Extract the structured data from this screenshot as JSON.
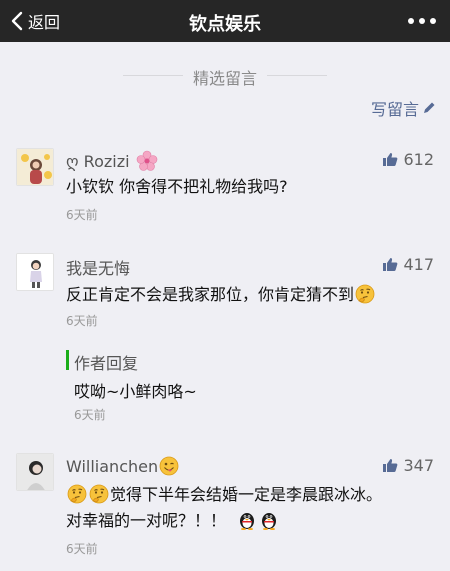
{
  "navbar": {
    "back_label": "返回",
    "title": "钦点娱乐"
  },
  "section": {
    "title": "精选留言",
    "write_label": "写留言"
  },
  "colors": {
    "navbar_bg": "#262626",
    "link": "#576b95",
    "reply_accent": "#1aad19"
  },
  "comments": [
    {
      "nickname": "ღ Rozizi",
      "nickname_icon": "cherry-blossom-icon",
      "likes": "612",
      "content": "小钦钦  你舍得不把礼物给我吗?",
      "time": "6天前"
    },
    {
      "nickname": "我是无悔",
      "likes": "417",
      "content": "反正肯定不会是我家那位，你肯定猜不到",
      "content_emoji": "thinking-face-icon",
      "time": "6天前",
      "reply": {
        "label": "作者回复",
        "content": "哎呦~小鲜肉咯~",
        "time": "6天前"
      }
    },
    {
      "nickname": "Willianchen",
      "nickname_emoji": "winking-tongue-face-icon",
      "likes": "347",
      "content_line1": "觉得下半年会结婚一定是李晨跟冰冰。",
      "content_line2": "对幸福的一对呢？！！",
      "content_emojis": [
        "thinking-face-icon",
        "thinking-face-icon",
        "penguin-icon",
        "penguin-icon"
      ],
      "time": "6天前"
    }
  ]
}
